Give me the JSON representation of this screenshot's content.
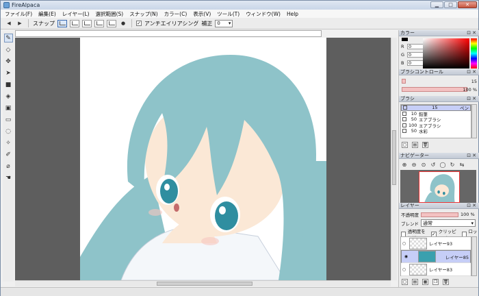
{
  "window": {
    "title": "FireAlpaca",
    "minimize": "▁",
    "maximize": "□",
    "close": "✕"
  },
  "menu": [
    "ファイル(F)",
    "編集(E)",
    "レイヤー(L)",
    "選択範囲(S)",
    "スナップ(N)",
    "カラー(C)",
    "表示(V)",
    "ツール(T)",
    "ウィンドウ(W)",
    "Help"
  ],
  "toolbar": {
    "snap_label": "スナップ",
    "antialias_label": "アンチエイリアシング",
    "antialias_checked": "✓",
    "correction_label": "補正",
    "correction_value": "0"
  },
  "tools": [
    "pen-tool-icon",
    "eraser-tool-icon",
    "move-tool-icon",
    "select-arrow-icon",
    "fill-rect-icon",
    "bucket-icon",
    "gradient-icon",
    "rect-select-icon",
    "lasso-icon",
    "magic-wand-icon",
    "select-pen-icon",
    "eyedropper-icon",
    "hand-icon"
  ],
  "color_panel": {
    "title": "カラー",
    "r_label": "R",
    "g_label": "G",
    "b_label": "B",
    "r": "0",
    "g": "0",
    "b": "0"
  },
  "brush_control": {
    "title": "ブラシコントロール",
    "size": "15",
    "opacity": "100 %",
    "size_fill": 0.06,
    "opacity_fill": 1.0
  },
  "brush_panel": {
    "title": "ブラシ",
    "items": [
      {
        "size": "15",
        "name": "ペン",
        "selected": true
      },
      {
        "size": "10",
        "name": "鉛筆",
        "selected": false
      },
      {
        "size": "50",
        "name": "エアブラシ",
        "selected": false
      },
      {
        "size": "100",
        "name": "エアブラシ",
        "selected": false
      },
      {
        "size": "50",
        "name": "水彩",
        "selected": false
      }
    ]
  },
  "navigator": {
    "title": "ナビゲーター"
  },
  "layer_panel": {
    "title": "レイヤー",
    "opacity_label": "不透明度",
    "opacity_value": "100 %",
    "blend_label": "ブレンド",
    "blend_value": "通常",
    "protect_label": "透明度を保護",
    "clipping_label": "クリッピング",
    "clipping_checked": "✓",
    "lock_label": "ロック",
    "layers": [
      {
        "name": "レイヤー93",
        "eye": "○"
      },
      {
        "name": "レイヤー85",
        "eye": "◉"
      },
      {
        "name": "レイヤー83",
        "eye": "○"
      }
    ]
  },
  "colors": {
    "hair": "#8ec3c9",
    "skin": "#fbe8d6",
    "eye": "#2f8ea0",
    "accent": "#c6cef7"
  }
}
